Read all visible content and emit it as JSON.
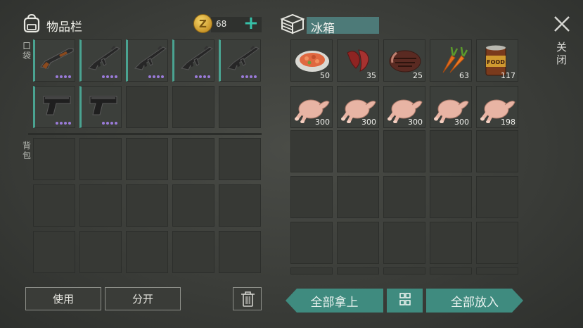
{
  "inventory": {
    "title": "物品栏",
    "coins": {
      "count": "68",
      "coin_symbol": "Z",
      "add_label": "+"
    },
    "pocket_label": "口袋",
    "backpack_label": "背包",
    "pocket_items": [
      {
        "icon": "shotgun-icon",
        "rarity_dots": 4
      },
      {
        "icon": "rifle-icon",
        "rarity_dots": 4
      },
      {
        "icon": "rifle-icon",
        "rarity_dots": 4
      },
      {
        "icon": "rifle-icon",
        "rarity_dots": 4
      },
      {
        "icon": "rifle-icon",
        "rarity_dots": 4
      },
      {
        "icon": "pistol-icon",
        "rarity_dots": 4
      },
      {
        "icon": "pistol-icon",
        "rarity_dots": 4
      }
    ],
    "use_label": "使用",
    "split_label": "分开"
  },
  "fridge": {
    "title": "冰箱",
    "items": [
      {
        "icon": "stew-bowl-icon",
        "qty": "50"
      },
      {
        "icon": "raw-meat-strips-icon",
        "qty": "35"
      },
      {
        "icon": "steak-icon",
        "qty": "25"
      },
      {
        "icon": "carrot-icon",
        "qty": "63"
      },
      {
        "icon": "canned-food-icon",
        "qty": "117"
      },
      {
        "icon": "raw-chicken-icon",
        "qty": "300"
      },
      {
        "icon": "raw-chicken-icon",
        "qty": "300"
      },
      {
        "icon": "raw-chicken-icon",
        "qty": "300"
      },
      {
        "icon": "raw-chicken-icon",
        "qty": "300"
      },
      {
        "icon": "raw-chicken-icon",
        "qty": "198"
      }
    ],
    "take_all_label": "全部拿上",
    "put_all_label": "全部放入"
  },
  "close_label": "关闭",
  "colors": {
    "accent": "#3f8b7f",
    "rarity": "#9a7bd9",
    "coin": "#e0b440"
  }
}
